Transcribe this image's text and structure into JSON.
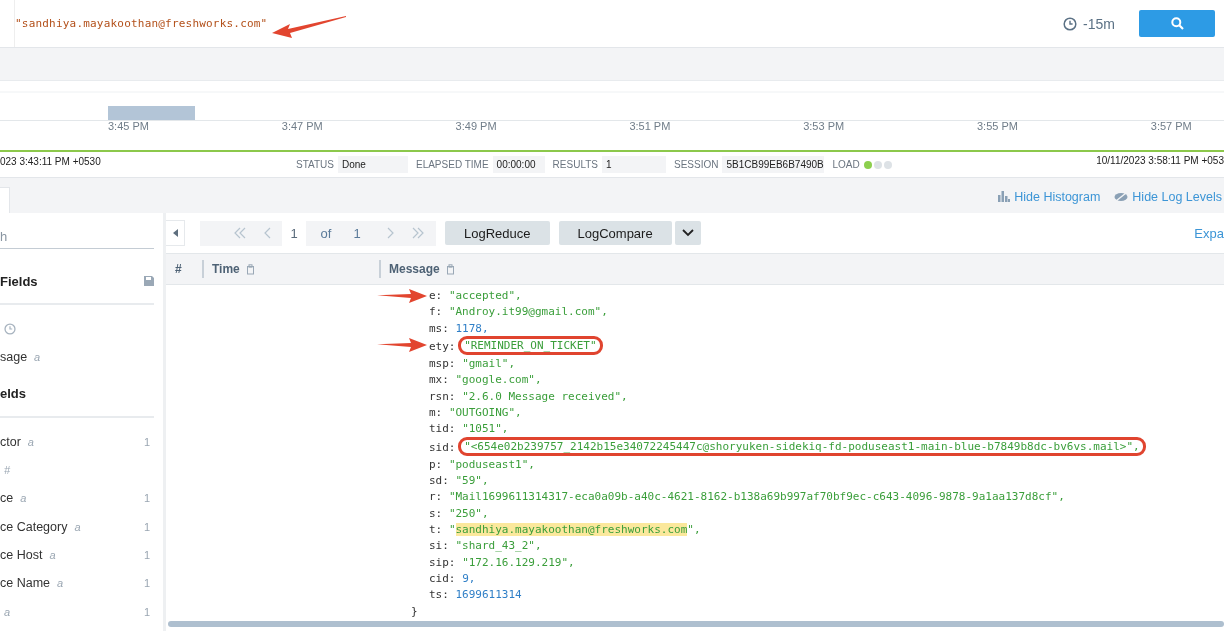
{
  "query": {
    "text": "\"sandhiya.mayakoothan@freshworks.com\"",
    "arrow": true
  },
  "time_range": "-15m",
  "histogram": {
    "tick_labels": [
      "3:45 PM",
      "3:47 PM",
      "3:49 PM",
      "3:51 PM",
      "3:53 PM",
      "3:55 PM",
      "3:57 PM"
    ]
  },
  "status_bar": {
    "start_time": "023 3:43:11 PM +0530",
    "status_label": "STATUS",
    "status": "Done",
    "elapsed_label": "ELAPSED TIME",
    "elapsed": "00:00:00",
    "results_label": "RESULTS",
    "results": "1",
    "session_label": "SESSION",
    "session": "5B1CB99EB6B7490B",
    "load_label": "LOAD",
    "load_dots": [
      {
        "on": true
      },
      {
        "on": false
      },
      {
        "on": false
      }
    ],
    "end_time": "10/11/2023 3:58:11 PM +053"
  },
  "view_links": [
    {
      "kind": "histogram",
      "label": "Hide Histogram"
    },
    {
      "kind": "levels",
      "label": "Hide Log Levels"
    }
  ],
  "sidebar": {
    "search_placeholder": "h",
    "sections": [
      {
        "title": "Fields",
        "save_icon": true,
        "fields": [
          {
            "kind": "time"
          },
          {
            "kind": "field",
            "name": "sage",
            "type": "a"
          }
        ]
      },
      {
        "title": "elds",
        "save_icon": false,
        "fields": [
          {
            "kind": "field",
            "name": "ctor",
            "type": "a",
            "count": "1"
          },
          {
            "kind": "field",
            "type": "#"
          },
          {
            "kind": "field",
            "name": "ce",
            "type": "a",
            "count": "1"
          },
          {
            "kind": "field",
            "name": "ce Category",
            "type": "a",
            "count": "1"
          },
          {
            "kind": "field",
            "name": "ce Host",
            "type": "a",
            "count": "1"
          },
          {
            "kind": "field",
            "name": "ce Name",
            "type": "a",
            "count": "1"
          },
          {
            "kind": "field",
            "type": "a",
            "count": "1"
          }
        ]
      }
    ]
  },
  "pager": {
    "page": "1",
    "of": "of",
    "total": "1"
  },
  "toolbar_buttons": [
    {
      "label": "LogReduce",
      "dropdown": false
    },
    {
      "label": "LogCompare",
      "dropdown": true
    }
  ],
  "expand_link": "Expa",
  "table": {
    "columns": [
      {
        "label": "#",
        "copy": false
      },
      {
        "label": "Time",
        "copy": true
      },
      {
        "label": "Message",
        "copy": true
      }
    ],
    "message_lines": [
      {
        "key": "e:",
        "arrow": true,
        "circled": false,
        "segments": [
          {
            "text": "\"accepted\",",
            "kind": "string",
            "highlighted": false
          }
        ]
      },
      {
        "key": "f:",
        "arrow": false,
        "circled": false,
        "segments": [
          {
            "text": "\"Androy.it99@gmail.com\",",
            "kind": "string",
            "highlighted": false
          }
        ]
      },
      {
        "key": "ms:",
        "arrow": false,
        "circled": false,
        "segments": [
          {
            "text": "1178,",
            "kind": "number",
            "highlighted": false
          }
        ]
      },
      {
        "key": "ety:",
        "arrow": true,
        "circled": true,
        "segments": [
          {
            "text": "\"REMINDER_ON_TICKET\"",
            "kind": "string",
            "highlighted": false
          }
        ]
      },
      {
        "key": "msp:",
        "arrow": false,
        "circled": false,
        "segments": [
          {
            "text": "\"gmail\",",
            "kind": "string",
            "highlighted": false
          }
        ]
      },
      {
        "key": "mx:",
        "arrow": false,
        "circled": false,
        "segments": [
          {
            "text": "\"google.com\",",
            "kind": "string",
            "highlighted": false
          }
        ]
      },
      {
        "key": "rsn:",
        "arrow": false,
        "circled": false,
        "segments": [
          {
            "text": "\"2.6.0 Message received\",",
            "kind": "string",
            "highlighted": false
          }
        ]
      },
      {
        "key": "m:",
        "arrow": false,
        "circled": false,
        "segments": [
          {
            "text": "\"OUTGOING\",",
            "kind": "string",
            "highlighted": false
          }
        ]
      },
      {
        "key": "tid:",
        "arrow": false,
        "circled": false,
        "segments": [
          {
            "text": "\"1051\",",
            "kind": "string",
            "highlighted": false
          }
        ]
      },
      {
        "key": "sid:",
        "arrow": false,
        "circled": true,
        "segments": [
          {
            "text": "\"<654e02b239757_2142b15e34072245447c@shoryuken-sidekiq-fd-poduseast1-main-blue-b7849b8dc-bv6vs.mail>\",",
            "kind": "string",
            "highlighted": false
          }
        ]
      },
      {
        "key": "p:",
        "arrow": false,
        "circled": false,
        "segments": [
          {
            "text": "\"poduseast1\",",
            "kind": "string",
            "highlighted": false
          }
        ]
      },
      {
        "key": "sd:",
        "arrow": false,
        "circled": false,
        "segments": [
          {
            "text": "\"59\",",
            "kind": "string",
            "highlighted": false
          }
        ]
      },
      {
        "key": "r:",
        "arrow": false,
        "circled": false,
        "segments": [
          {
            "text": "\"Mail1699611314317-eca0a09b-a40c-4621-8162-b138a69b997af70bf9ec-c643-4096-9878-9a1aa137d8cf\",",
            "kind": "string",
            "highlighted": false
          }
        ]
      },
      {
        "key": "s:",
        "arrow": false,
        "circled": false,
        "segments": [
          {
            "text": "\"250\",",
            "kind": "string",
            "highlighted": false
          }
        ]
      },
      {
        "key": "t:",
        "arrow": false,
        "circled": false,
        "segments": [
          {
            "text": "\"",
            "kind": "string",
            "highlighted": false
          },
          {
            "text": "sandhiya.mayakoothan@freshworks.com",
            "kind": "string",
            "highlighted": true
          },
          {
            "text": "\",",
            "kind": "string",
            "highlighted": false
          }
        ]
      },
      {
        "key": "si:",
        "arrow": false,
        "circled": false,
        "segments": [
          {
            "text": "\"shard_43_2\",",
            "kind": "string",
            "highlighted": false
          }
        ]
      },
      {
        "key": "sip:",
        "arrow": false,
        "circled": false,
        "segments": [
          {
            "text": "\"172.16.129.219\",",
            "kind": "string",
            "highlighted": false
          }
        ]
      },
      {
        "key": "cid:",
        "arrow": false,
        "circled": false,
        "segments": [
          {
            "text": "9,",
            "kind": "number",
            "highlighted": false
          }
        ]
      },
      {
        "key": "ts:",
        "arrow": false,
        "circled": false,
        "segments": [
          {
            "text": "1699611314",
            "kind": "number",
            "highlighted": false
          }
        ]
      }
    ],
    "closing": "}"
  }
}
